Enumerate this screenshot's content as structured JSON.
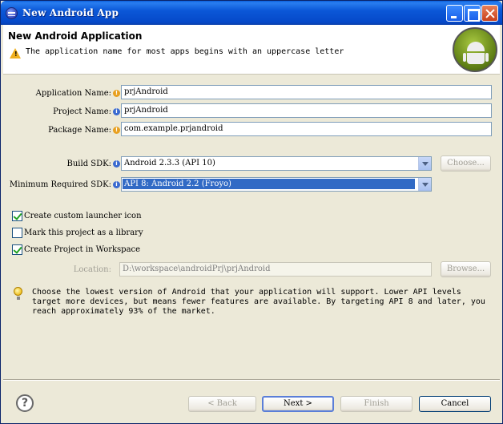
{
  "window": {
    "title": "New Android App"
  },
  "banner": {
    "title": "New Android Application",
    "message": "The application name for most apps begins with an uppercase letter"
  },
  "form": {
    "application_name": {
      "label": "Application Name:",
      "value": "prjAndroid"
    },
    "project_name": {
      "label": "Project Name:",
      "value": "prjAndroid"
    },
    "package_name": {
      "label": "Package Name:",
      "value": "com.example.prjandroid"
    },
    "build_sdk": {
      "label": "Build SDK:",
      "value": "Android 2.3.3 (API 10)"
    },
    "choose_button": "Choose...",
    "min_sdk": {
      "label": "Minimum Required SDK:",
      "value": "API 8: Android 2.2 (Froyo)"
    },
    "checkboxes": [
      {
        "label": "Create custom launcher icon",
        "checked": true
      },
      {
        "label": "Mark this project as a library",
        "checked": false
      },
      {
        "label": "Create Project in Workspace",
        "checked": true
      }
    ],
    "location": {
      "label": "Location:",
      "value": "D:\\workspace\\androidPrj\\prjAndroid"
    },
    "browse_button": "Browse..."
  },
  "hint": "Choose the lowest version of Android that your application will support. Lower API levels target more devices, but means fewer features are available. By targeting API 8 and later, you reach approximately 93% of the market.",
  "footer": {
    "help": "?",
    "back": "< Back",
    "next": "Next >",
    "finish": "Finish",
    "cancel": "Cancel"
  }
}
